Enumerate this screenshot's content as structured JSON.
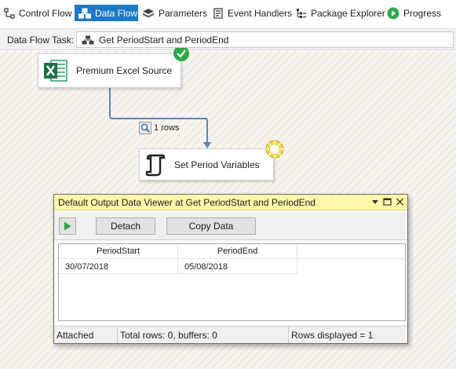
{
  "tabs": [
    {
      "label": "Control Flow",
      "icon": "control-flow-icon",
      "active": false
    },
    {
      "label": "Data Flow",
      "icon": "data-flow-icon",
      "active": true
    },
    {
      "label": "Parameters",
      "icon": "parameters-icon",
      "active": false
    },
    {
      "label": "Event Handlers",
      "icon": "event-handlers-icon",
      "active": false
    },
    {
      "label": "Package Explorer",
      "icon": "package-explorer-icon",
      "active": false
    },
    {
      "label": "Progress",
      "icon": "progress-icon",
      "active": false
    }
  ],
  "task": {
    "label": "Data Flow Task:",
    "selected": "Get PeriodStart and PeriodEnd"
  },
  "canvas": {
    "source_component": {
      "label": "Premium Excel Source",
      "icon": "excel-icon",
      "status": "success"
    },
    "path": {
      "label": "1 rows",
      "icon": "magnifier-icon"
    },
    "target_component": {
      "label": "Set Period Variables",
      "icon": "script-component-icon",
      "status": "executing"
    }
  },
  "viewer": {
    "title": "Default Output Data Viewer at Get PeriodStart and PeriodEnd",
    "buttons": {
      "detach": "Detach",
      "copy": "Copy Data"
    },
    "columns": [
      "PeriodStart",
      "PeriodEnd"
    ],
    "rows": [
      [
        "30/07/2018",
        "05/08/2018"
      ]
    ],
    "status": {
      "state": "Attached",
      "totals": "Total rows: 0, buffers: 0",
      "displayed": "Rows displayed = 1"
    }
  },
  "colors": {
    "active_tab": "#1d79c7",
    "success": "#2ea84a",
    "viewer_title_bg": "#fff7a8",
    "path_line": "#5b86b6"
  }
}
